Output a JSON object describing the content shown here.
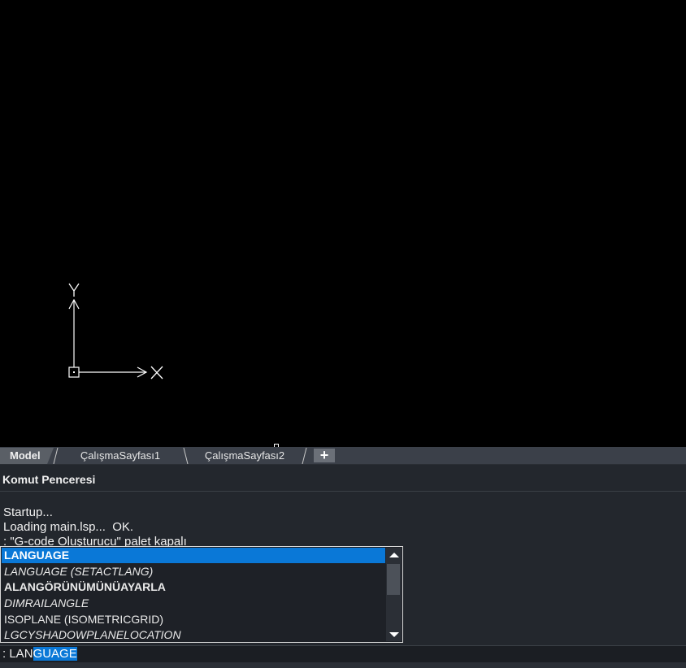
{
  "ucs": {
    "x_label": "X",
    "y_label": "Y"
  },
  "tabs": [
    {
      "label": "Model",
      "active": true
    },
    {
      "label": "ÇalışmaSayfası1",
      "active": false
    },
    {
      "label": "ÇalışmaSayfası2",
      "active": false
    }
  ],
  "add_tab_label": "+",
  "command_window": {
    "title": "Komut Penceresi",
    "history": [
      "Startup...",
      "Loading main.lsp...  OK.",
      ": \"G-code Oluşturucu\" palet kapalı"
    ]
  },
  "autocomplete": {
    "items": [
      {
        "label": "LANGUAGE",
        "style": "selected"
      },
      {
        "label": "LANGUAGE (SETACTLANG)",
        "style": "italic"
      },
      {
        "label": "ALANGÖRÜNÜMÜNÜAYARLA",
        "style": "bold"
      },
      {
        "label": "DIMRAILANGLE",
        "style": "italic"
      },
      {
        "label": "ISOPLANE (ISOMETRICGRID)",
        "style": "normal"
      },
      {
        "label": "LGCYSHADOWPLANELOCATION",
        "style": "italic"
      }
    ]
  },
  "command_input": {
    "prompt": ": ",
    "typed": "LAN",
    "completion": "GUAGE"
  },
  "colors": {
    "selection": "#0a78d7",
    "panel": "#23272d",
    "canvas": "#000000"
  }
}
